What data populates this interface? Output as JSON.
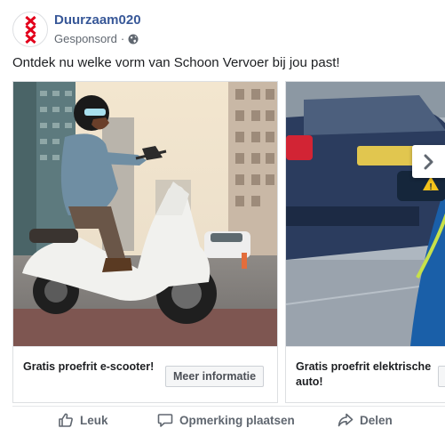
{
  "page": {
    "name": "Duurzaam020",
    "sponsored_label": "Gesponsord",
    "separator": "·",
    "globe_icon": "globe-icon"
  },
  "caption": "Ontdek nu welke vorm van Schoon Vervoer bij jou past!",
  "cards": [
    {
      "title": "Gratis proefrit e-scooter!",
      "cta": "Meer informatie",
      "image": "man-on-white-scooter"
    },
    {
      "title": "Gratis proefrit elektrische auto!",
      "cta": "",
      "image": "electric-car-charging"
    }
  ],
  "next_icon": "chevron-right-icon",
  "actions": {
    "like": "Leuk",
    "comment": "Opmerking plaatsen",
    "share": "Delen"
  },
  "colors": {
    "page_name": "#385898",
    "meta_text": "#606770",
    "logo_cross": "#e3001b"
  }
}
